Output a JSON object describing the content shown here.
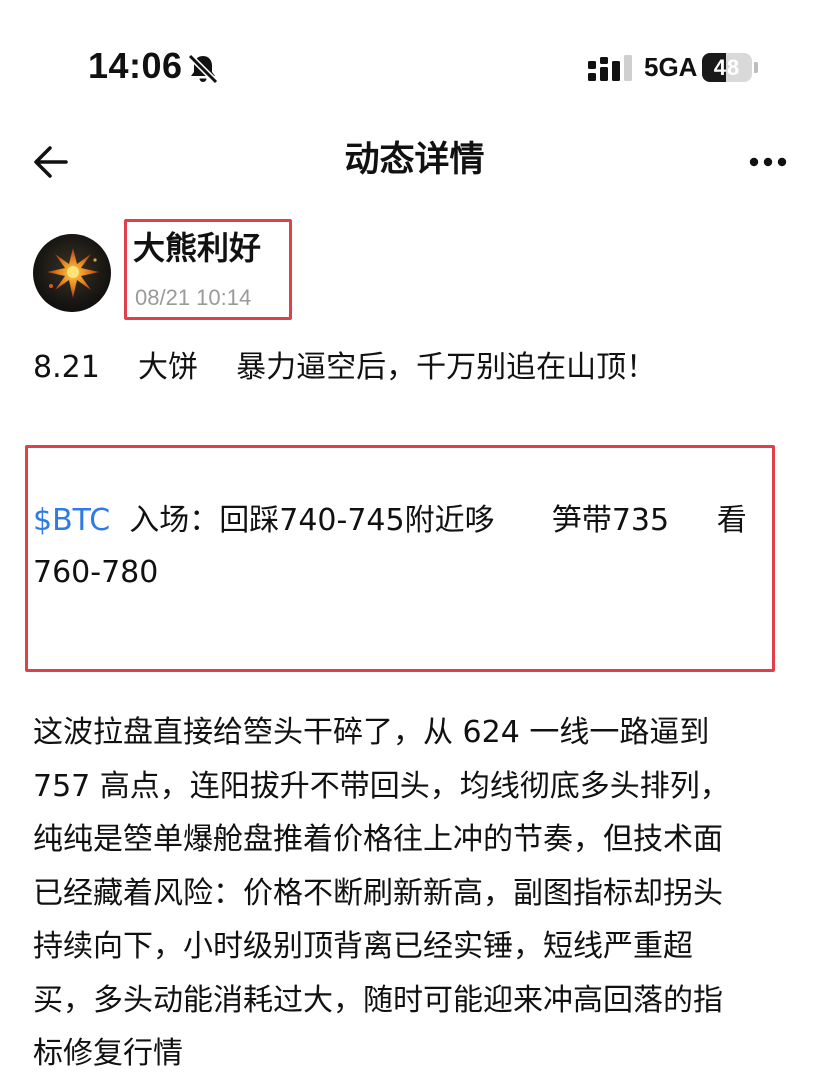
{
  "status_bar": {
    "time": "14:06",
    "network": "5GA",
    "battery_level": "48",
    "battery_fraction": 0.48,
    "icons": [
      "bell-muted-icon",
      "signal-icon"
    ]
  },
  "nav": {
    "title": "动态详情",
    "back_icon": "arrow-left-icon",
    "more_icon": "more-dots-icon"
  },
  "author": {
    "name": "大熊利好",
    "post_time": "08/21 10:14",
    "highlight_color": "#e0404a"
  },
  "post": {
    "headline": "8.21    大饼    暴力逼空后，千万别追在山顶！",
    "signal": {
      "ticker": "$BTC",
      "line1_text": "  入场：回踩740-745附近哆      笋带735     看",
      "line2_text": "760-780",
      "ticker_color": "#2e7be6"
    },
    "body_lines": [
      "这波拉盘直接给箜头干碎了，从 624 一线一路逼到",
      "757 高点，连阳拔升不带回头，均线彻底多头排列，",
      "纯纯是箜单爆舱盘推着价格往上冲的节奏，但技术面",
      "已经藏着风险：价格不断刷新新高，副图指标却拐头",
      "持续向下，小时级别顶背离已经实锤，短线严重超",
      "买，多头动能消耗过大，随时可能迎来冲高回落的指",
      "标修复行情"
    ]
  }
}
